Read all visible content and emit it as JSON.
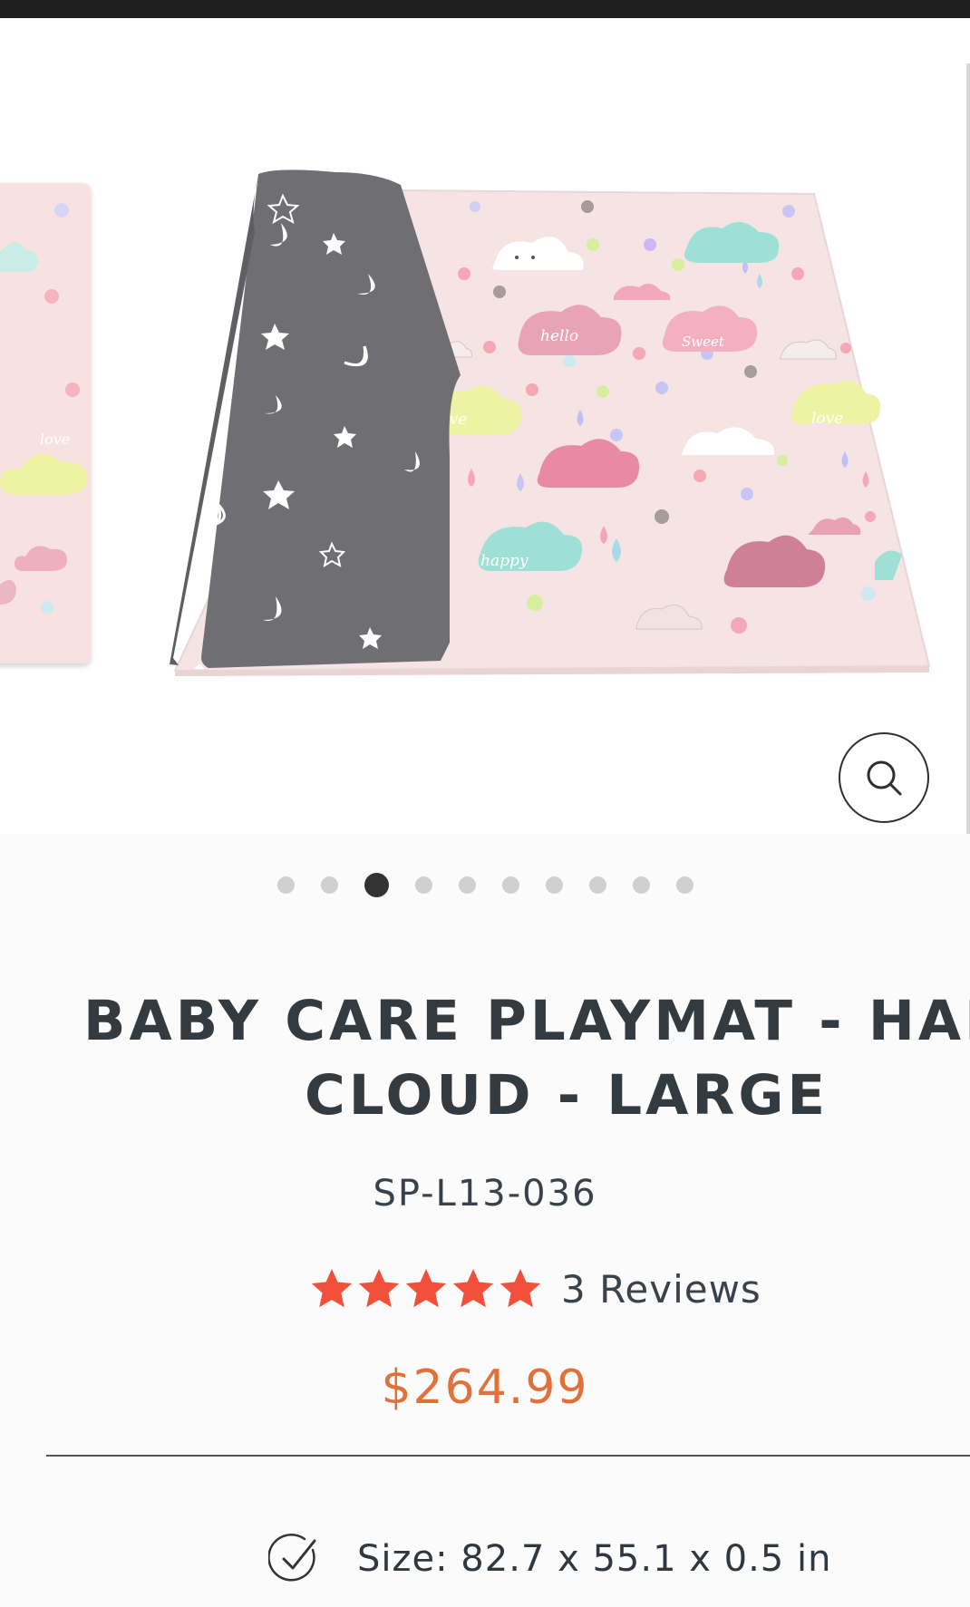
{
  "product": {
    "title_line1": "BABY CARE PLAYMAT - HAPP",
    "title_line2": "CLOUD - LARGE",
    "sku": "SP-L13-036",
    "rating_value": 5,
    "rating_max": 5,
    "reviews": "3 Reviews",
    "price": "$264.99",
    "feature_text": "Size: 82.7 x 55.1 x 0.5 in"
  },
  "gallery": {
    "current_slide": 3,
    "total_slides": 10,
    "mat_labels": {
      "hello": "hello",
      "sweet": "Sweet",
      "love": "love",
      "happy": "happy"
    }
  },
  "colors": {
    "accent_price": "#e0713b",
    "stars": "#f2503a",
    "title": "#333a40",
    "mat_pink": "#f6e3e3",
    "mat_gray": "#6f6f73"
  },
  "icons": {
    "zoom": "search-icon",
    "feature": "check-circle-icon",
    "rating": "star-icon"
  }
}
